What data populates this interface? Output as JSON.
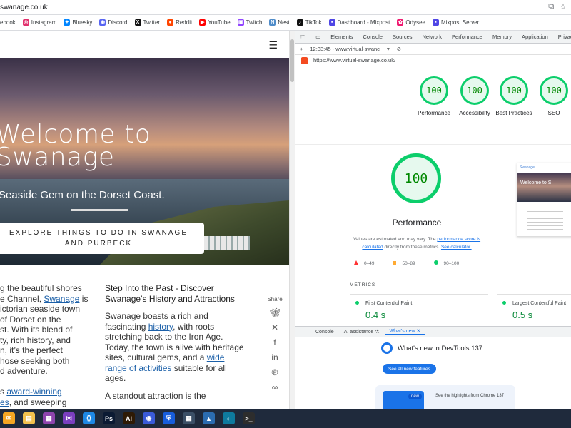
{
  "browser": {
    "url": "swanage.co.uk",
    "bookmarks": [
      {
        "label": "ebook",
        "color": "#1877f2",
        "glyph": ""
      },
      {
        "label": "Instagram",
        "color": "#e1306c",
        "glyph": "◎"
      },
      {
        "label": "Bluesky",
        "color": "#0085ff",
        "glyph": "✦"
      },
      {
        "label": "Discord",
        "color": "#5865f2",
        "glyph": "◉"
      },
      {
        "label": "Twitter",
        "color": "#111111",
        "glyph": "X"
      },
      {
        "label": "Reddit",
        "color": "#ff4500",
        "glyph": "●"
      },
      {
        "label": "YouTube",
        "color": "#ff0000",
        "glyph": "▶"
      },
      {
        "label": "Twitch",
        "color": "#9146ff",
        "glyph": "▣"
      },
      {
        "label": "Nest",
        "color": "#4f8cc9",
        "glyph": "N"
      },
      {
        "label": "TikTok",
        "color": "#111111",
        "glyph": "♪"
      },
      {
        "label": "Dashboard - Mixpost",
        "color": "#4f46e5",
        "glyph": "▪"
      },
      {
        "label": "Odysee",
        "color": "#ef1970",
        "glyph": "✿"
      },
      {
        "label": "Mixpost Server",
        "color": "#4f46e5",
        "glyph": "▪"
      }
    ]
  },
  "site": {
    "hero_title_line1": "Welcome to",
    "hero_title_line2": "Swanage",
    "hero_subtitle": "Seaside Gem on the Dorset Coast.",
    "cta_label": "EXPLORE THINGS TO DO IN SWANAGE AND PURBECK",
    "col1": {
      "t1": "g the beautiful shores",
      "t2": "e Channel, ",
      "link1": "Swanage",
      "t3": " is",
      "t4": "ictorian seaside town",
      "t5": "of Dorset on the",
      "t6": "st. With its blend of",
      "t7": "ty, rich history, and",
      "t8": "n, it’s the perfect",
      "t9": "hose seeking both",
      "t10": "d adventure.",
      "t11": "s ",
      "link2": "award-winning",
      "link3": "es",
      "t12": ", and sweeping"
    },
    "col2": {
      "heading": "Step Into the Past - Discover Swanage’s History and Attractions",
      "p1a": "Swanage boasts a rich and fascinating ",
      "p1link": "history",
      "p1b": ", with roots stretching back to the Iron Age. Today, the town is alive with heritage sites, cultural gems, and a ",
      "p1link2": "wide range of activities",
      "p1c": " suitable for all ages.",
      "p2": "A standout attraction is the"
    },
    "share_label": "Share"
  },
  "devtools": {
    "tabs": [
      "Elements",
      "Console",
      "Sources",
      "Network",
      "Performance",
      "Memory",
      "Application",
      "Privacy and secu"
    ],
    "report_time": "12:33:45 - www.virtual-swanc",
    "report_url": "https://www.virtual-swanage.co.uk/",
    "gauges": [
      {
        "score": "100",
        "label": "Performance"
      },
      {
        "score": "100",
        "label": "Accessibility"
      },
      {
        "score": "100",
        "label": "Best Practices"
      },
      {
        "score": "100",
        "label": "SEO"
      }
    ],
    "big_score": "100",
    "big_title": "Performance",
    "note_a": "Values are estimated and may vary. The ",
    "note_link1": "performance score is calculated",
    "note_b": " directly from these metrics. ",
    "note_link2": "See calculator.",
    "legend": [
      "0–49",
      "50–89",
      "90–100"
    ],
    "thumb_logo": "Swanage",
    "thumb_title": "Welcome to S",
    "metrics_heading": "METRICS",
    "fcp_label": "First Contentful Paint",
    "fcp_value": "0.4 s",
    "lcp_label": "Largest Contentful Paint",
    "lcp_value": "0.5 s",
    "drawer_tabs": [
      "Console",
      "AI assistance",
      "What's new"
    ],
    "whats_new_title": "What's new in DevTools 137",
    "see_all": "See all new features",
    "new_badge": "new",
    "highlight_text": "See the highlights from Chrome 137"
  },
  "taskbar": {
    "apps": [
      {
        "name": "mail",
        "color": "#f5a623",
        "glyph": "✉"
      },
      {
        "name": "files",
        "color": "#f2c14e",
        "glyph": "▤"
      },
      {
        "name": "app3",
        "color": "#8e44ad",
        "glyph": "▦"
      },
      {
        "name": "visual-studio",
        "color": "#7b3fbf",
        "glyph": "⋈"
      },
      {
        "name": "vscode",
        "color": "#1e88e5",
        "glyph": "⟨⟩"
      },
      {
        "name": "photoshop",
        "color": "#0b1a33",
        "glyph": "Ps"
      },
      {
        "name": "illustrator",
        "color": "#2e1a05",
        "glyph": "Ai"
      },
      {
        "name": "chat",
        "color": "#3a5bd9",
        "glyph": "◉"
      },
      {
        "name": "bitwarden",
        "color": "#175ddc",
        "glyph": "⛨"
      },
      {
        "name": "calculator",
        "color": "#3b4f66",
        "glyph": "▦"
      },
      {
        "name": "app11",
        "color": "#2b6cb0",
        "glyph": "▲"
      },
      {
        "name": "edge",
        "color": "#0e7a9e",
        "glyph": "◐"
      },
      {
        "name": "terminal",
        "color": "#2d2d2d",
        "glyph": ">_"
      }
    ]
  }
}
